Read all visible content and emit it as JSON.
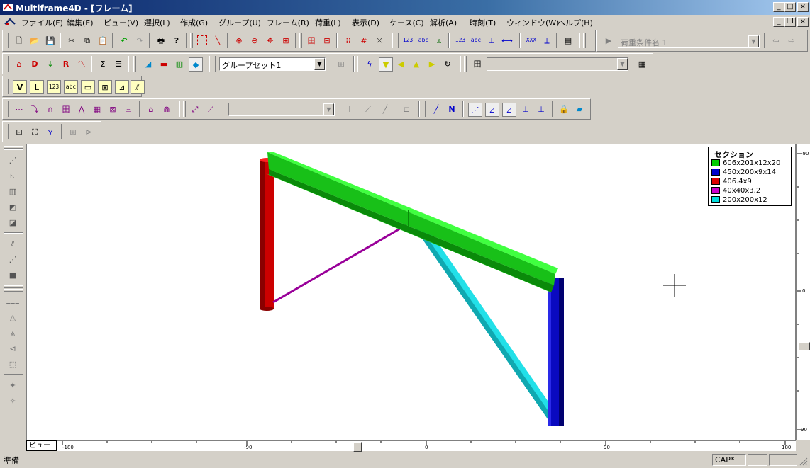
{
  "window": {
    "app_title": "Multiframe4D - [フレーム]"
  },
  "menu": [
    "ファイル(F)",
    "編集(E)",
    "ビュー(V)",
    "選択(L)",
    "作成(G)",
    "グループ(U)",
    "フレーム(R)",
    "荷重(L)",
    "表示(D)",
    "ケース(C)",
    "解析(A)",
    "時刻(T)",
    "ウィンドウ(W)",
    "ヘルプ(H)"
  ],
  "toolbar": {
    "load_case_placeholder": "荷重条件名 1",
    "group_set": "グループセット1",
    "label_123": "123",
    "label_abc": "abc",
    "label_xxx": "XXX"
  },
  "legend": {
    "title": "セクション",
    "items": [
      {
        "label": "606x201x12x20",
        "color": "#00cc00"
      },
      {
        "label": "450x200x9x14",
        "color": "#0000cc"
      },
      {
        "label": "406.4x9",
        "color": "#dd0000"
      },
      {
        "label": "40x40x3.2",
        "color": "#cc00cc"
      },
      {
        "label": "200x200x12",
        "color": "#00dddd"
      }
    ]
  },
  "rulers": {
    "bottom": [
      "-180",
      "-90",
      "0",
      "90",
      "180"
    ],
    "right": [
      "-90",
      "0",
      "90"
    ]
  },
  "view_tab": "ビュー",
  "status": {
    "ready": "準備",
    "cap": "CAP*"
  }
}
